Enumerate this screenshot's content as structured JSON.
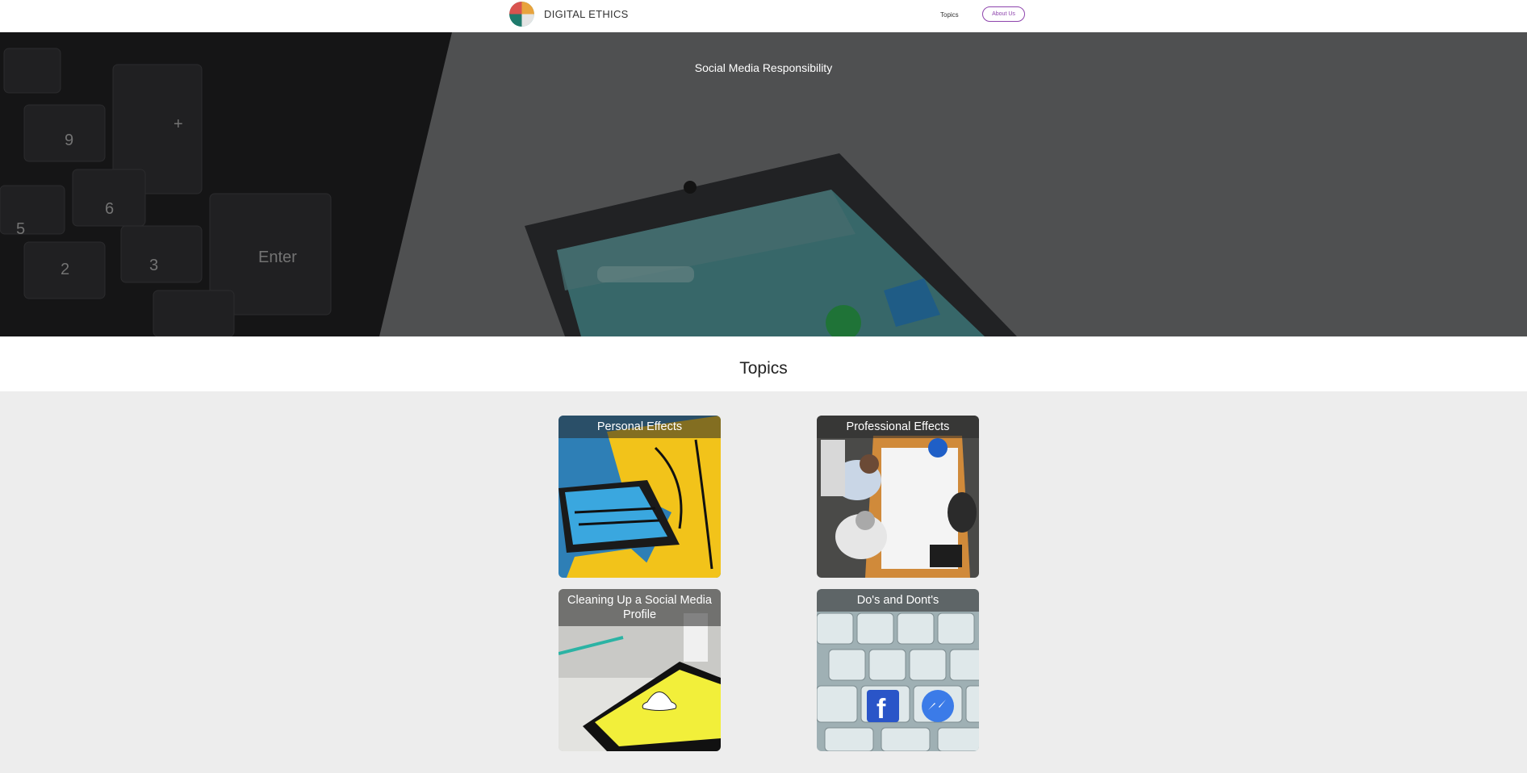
{
  "header": {
    "brand": "DIGITAL ETHICS",
    "nav": {
      "topics": "Topics",
      "about": "About Us"
    }
  },
  "hero": {
    "title": "Social Media Responsibility"
  },
  "topics": {
    "heading": "Topics",
    "cards": [
      {
        "label": "Personal Effects"
      },
      {
        "label": "Professional Effects"
      },
      {
        "label": "Cleaning Up a Social Media Profile"
      },
      {
        "label": "Do's and Dont's"
      }
    ]
  },
  "colors": {
    "accent": "#8e44ad",
    "section_bg": "#ededed"
  }
}
